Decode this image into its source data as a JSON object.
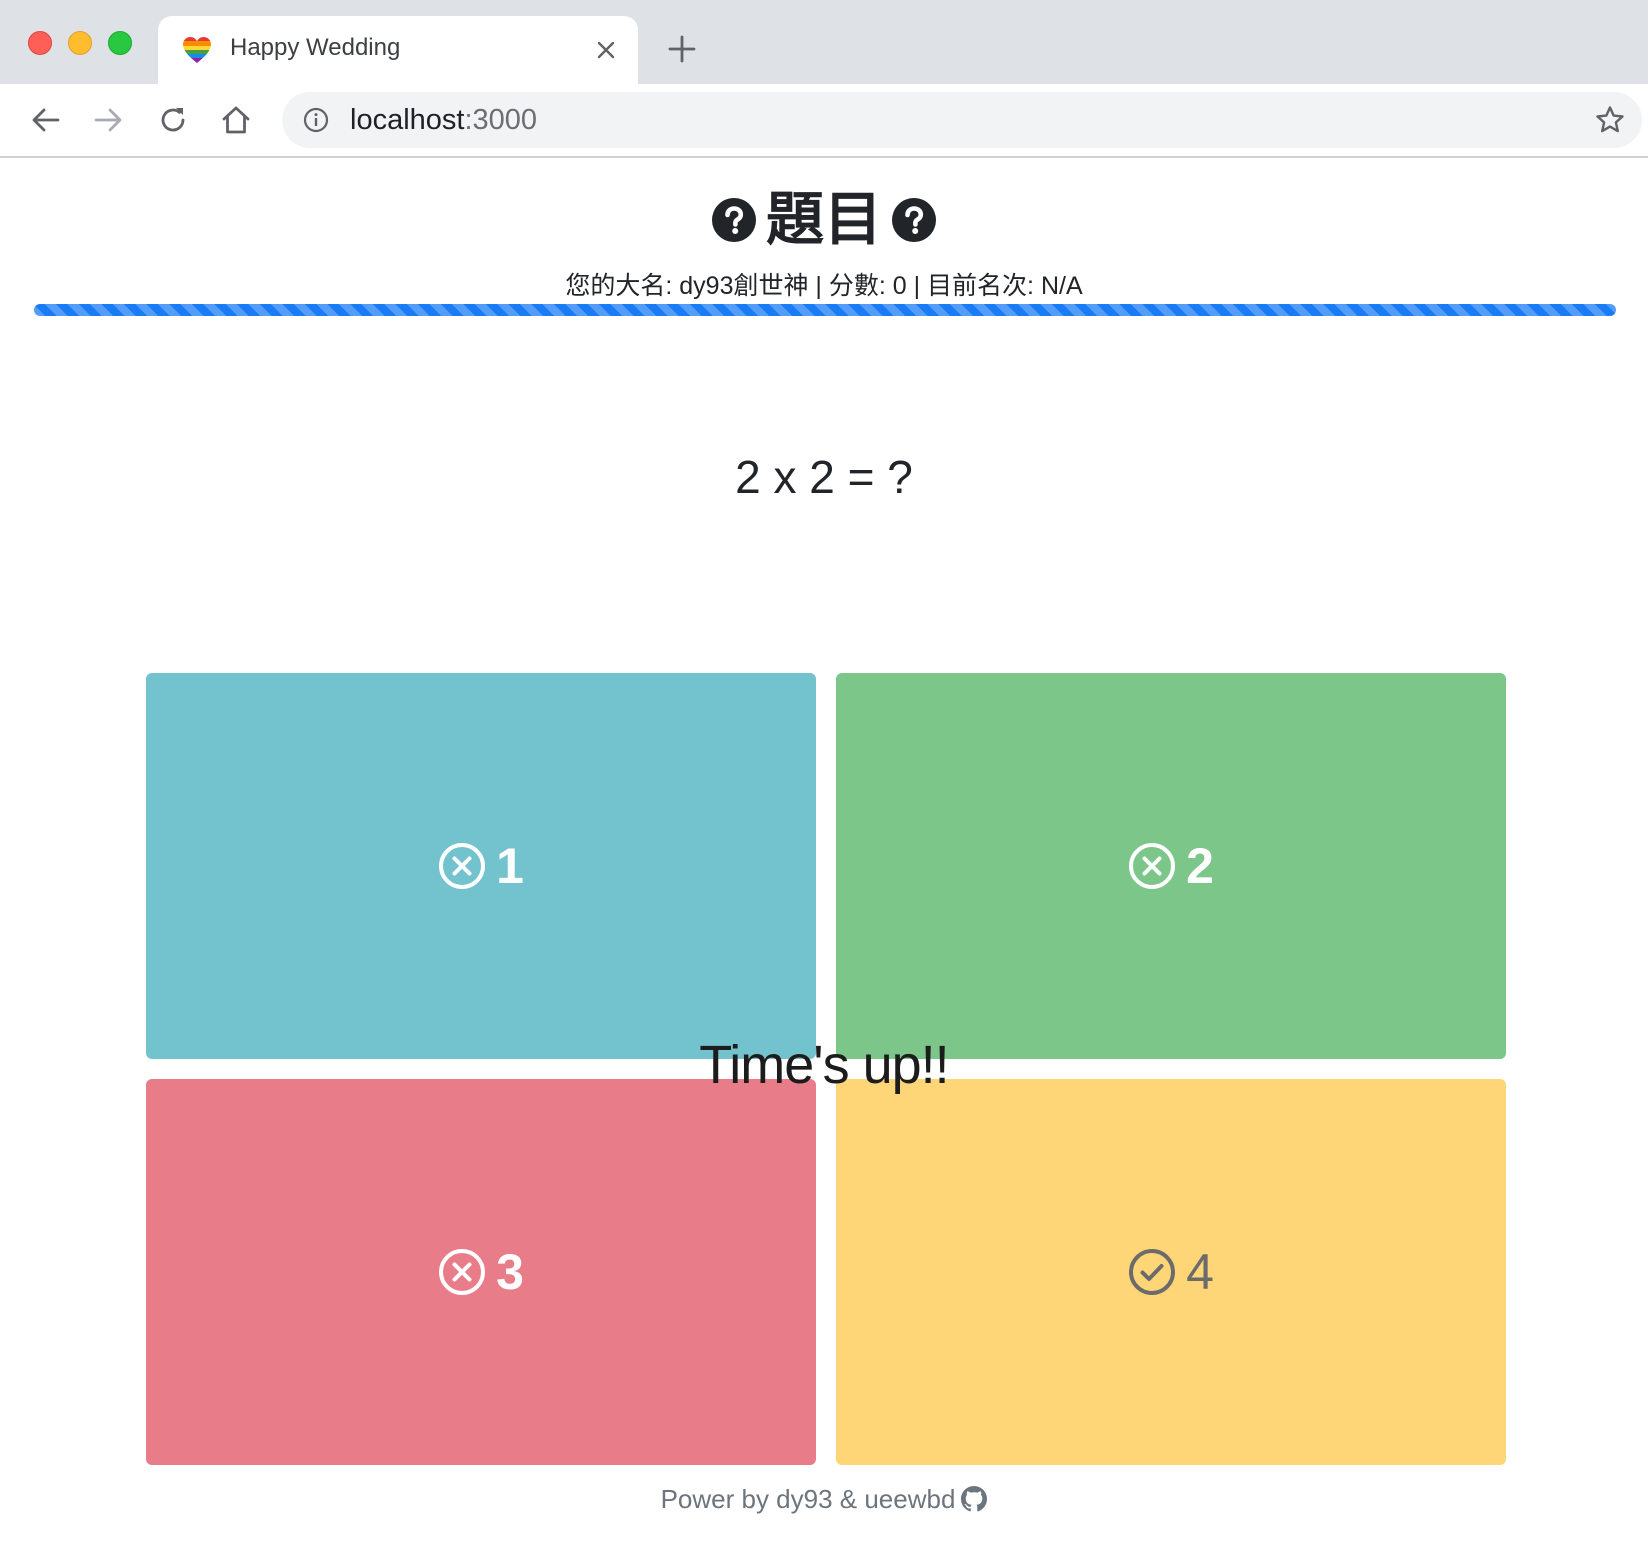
{
  "browser": {
    "tab_title": "Happy Wedding",
    "tab_favicon": "rainbow-heart-icon",
    "url_host": "localhost",
    "url_port": ":3000",
    "icons": {
      "back": "arrow-left-icon",
      "forward": "arrow-right-icon",
      "reload": "reload-icon",
      "home": "home-icon",
      "info": "info-icon",
      "bookmark": "star-icon",
      "close_tab": "close-icon",
      "new_tab": "plus-icon"
    }
  },
  "quiz": {
    "heading": "題目",
    "heading_icon": "question-circle-icon",
    "player_line": "您的大名: dy93創世神 | 分數: 0 | 目前名次: N/A",
    "progress_percent": 100,
    "progress_color": "#1a7cf5",
    "question": "2 x 2 = ?",
    "answers": [
      {
        "label": "1",
        "status": "wrong",
        "icon": "x-circle-icon",
        "color": "#73c3cf"
      },
      {
        "label": "2",
        "status": "wrong",
        "icon": "x-circle-icon",
        "color": "#7cc68a"
      },
      {
        "label": "3",
        "status": "wrong",
        "icon": "x-circle-icon",
        "color": "#e87d89"
      },
      {
        "label": "4",
        "status": "correct",
        "icon": "check-circle-icon",
        "color": "#fed577"
      }
    ],
    "overlay_message": "Time's up!!"
  },
  "footer": {
    "text": "Power by dy93 & ueewbd",
    "icon": "github-icon"
  }
}
